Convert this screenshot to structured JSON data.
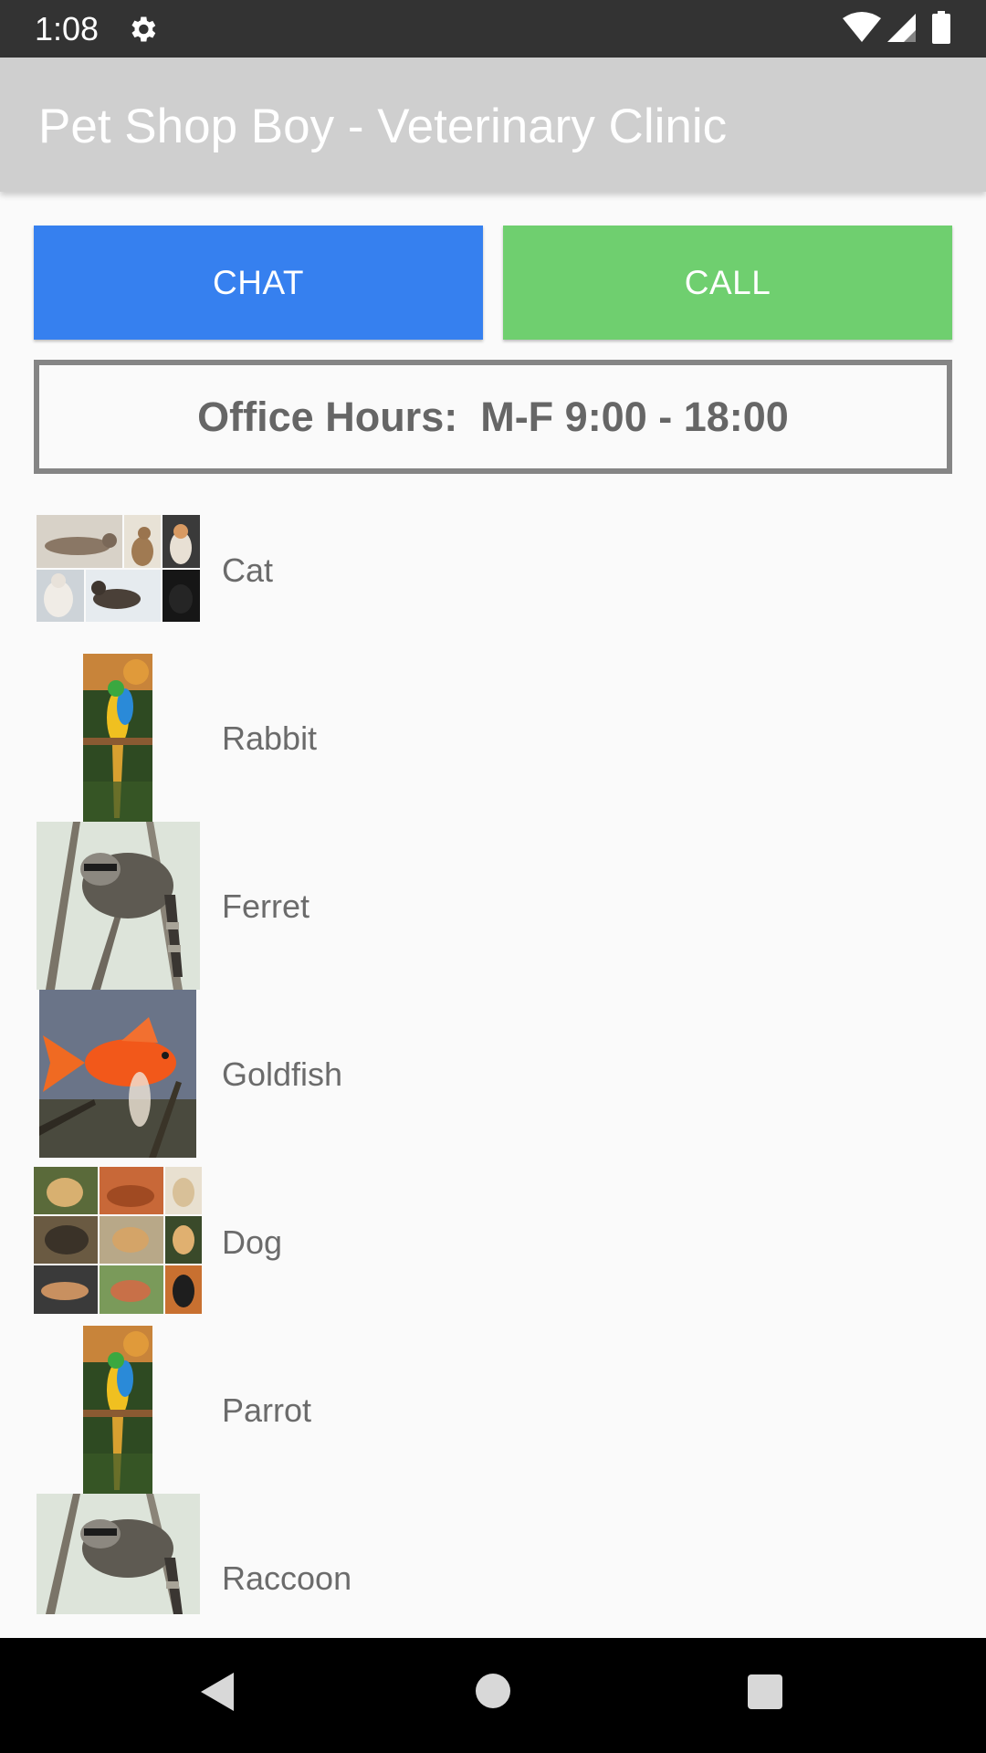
{
  "status_bar": {
    "time": "1:08",
    "icons": [
      "gear-icon",
      "wifi-icon",
      "signal-icon",
      "battery-icon"
    ]
  },
  "app_bar": {
    "title": "Pet Shop Boy - Veterinary Clinic",
    "background": "#cfcfcf"
  },
  "buttons": {
    "chat_label": "CHAT",
    "call_label": "CALL",
    "chat_color": "#3680ef",
    "call_color": "#6fcf6f"
  },
  "office_hours": {
    "text": "Office Hours:  M-F 9:00 - 18:00"
  },
  "pets": [
    {
      "label": "Cat",
      "image": "cat-collage"
    },
    {
      "label": "Rabbit",
      "image": "parrot-photo"
    },
    {
      "label": "Ferret",
      "image": "raccoon-photo"
    },
    {
      "label": "Goldfish",
      "image": "goldfish-photo"
    },
    {
      "label": "Dog",
      "image": "dog-collage"
    },
    {
      "label": "Parrot",
      "image": "parrot-photo"
    },
    {
      "label": "Raccoon",
      "image": "raccoon-photo"
    }
  ],
  "nav_bar": {
    "icons": [
      "back-icon",
      "home-icon",
      "recents-icon"
    ]
  }
}
